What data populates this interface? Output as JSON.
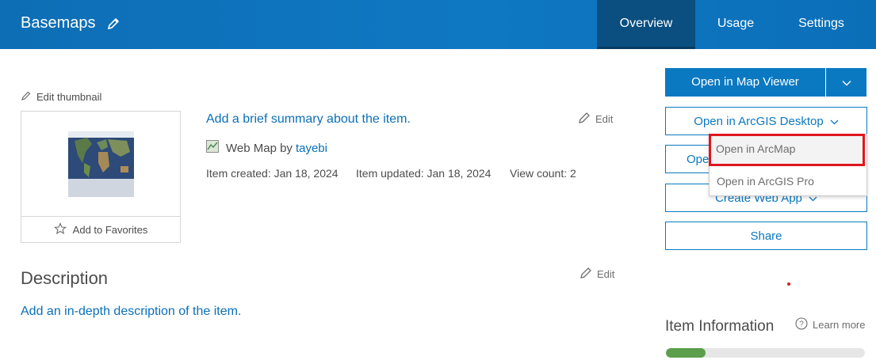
{
  "header": {
    "title": "Basemaps",
    "tabs": [
      {
        "label": "Overview",
        "active": true
      },
      {
        "label": "Usage",
        "active": false
      },
      {
        "label": "Settings",
        "active": false
      }
    ]
  },
  "thumbnail": {
    "edit_label": "Edit thumbnail",
    "favorites_label": "Add to Favorites"
  },
  "summary": {
    "link_text": "Add a brief summary about the item.",
    "edit_label": "Edit",
    "type_text": "Web Map by",
    "owner": "tayebi",
    "created": "Item created: Jan 18, 2024",
    "updated": "Item updated: Jan 18, 2024",
    "views": "View count: 2"
  },
  "description": {
    "heading": "Description",
    "edit_label": "Edit",
    "link_text": "Add an in-depth description of the item."
  },
  "actions": {
    "open_map_viewer": "Open in Map Viewer",
    "open_desktop": "Open in ArcGIS Desktop",
    "hidden_partial": "Ope",
    "create_web_app": "Create Web App",
    "share": "Share",
    "dropdown": {
      "arcmap": "Open in ArcMap",
      "pro": "Open in ArcGIS Pro"
    }
  },
  "item_info": {
    "heading": "Item Information",
    "learn_more": "Learn more",
    "progress_fraction": 0.2
  },
  "colors": {
    "header_blue": "#0f78c3",
    "active_tab": "#0a4f80",
    "link_blue": "#0b6fb8",
    "highlight_red": "#e0161d",
    "progress_green": "#5b9e4b"
  }
}
